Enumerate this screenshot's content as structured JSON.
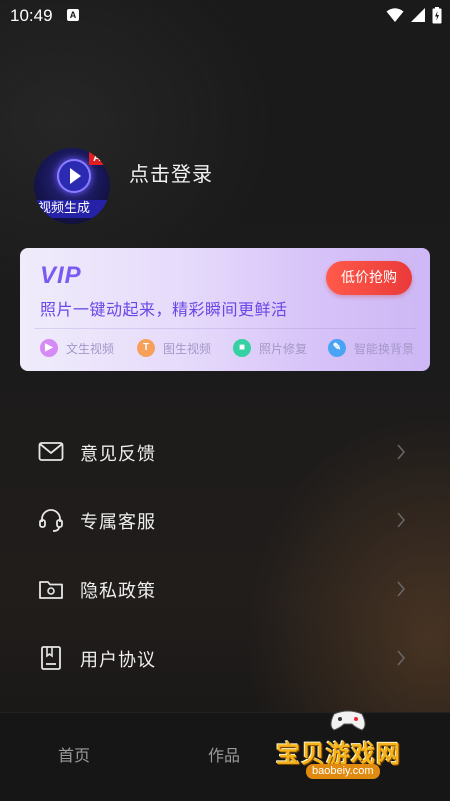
{
  "status": {
    "time": "10:49",
    "notif_letter": "A"
  },
  "profile": {
    "login_text": "点击登录",
    "avatar_badge": "AI",
    "avatar_banner": "视频生成"
  },
  "vip": {
    "logo": "VIP",
    "slogan": "照片一键动起来，精彩瞬间更鲜活",
    "cta": "低价抢购",
    "features": [
      {
        "icon": "play-icon",
        "glyph": "▶",
        "label": "文生视频",
        "color": "#d58af5"
      },
      {
        "icon": "text-icon",
        "glyph": "T",
        "label": "图生视频",
        "color": "#f6a05a"
      },
      {
        "icon": "video-camera-icon",
        "glyph": "■",
        "label": "照片修复",
        "color": "#36d1a3"
      },
      {
        "icon": "wrench-icon",
        "glyph": "✎",
        "label": "智能换背景",
        "color": "#4aa3f5"
      }
    ]
  },
  "menu": [
    {
      "label": "意见反馈",
      "icon": "mail-icon"
    },
    {
      "label": "专属客服",
      "icon": "headset-icon"
    },
    {
      "label": "隐私政策",
      "icon": "folder-gear-icon"
    },
    {
      "label": "用户协议",
      "icon": "document-icon"
    }
  ],
  "bottom_nav": {
    "tabs": [
      "首页",
      "作品"
    ]
  },
  "watermark": {
    "title": "宝贝游戏网",
    "url": "baobeiy.com"
  },
  "colors": {
    "accent_purple": "#6a46e6",
    "cta_red": "#ea3a3a",
    "background": "#1a1a1a"
  }
}
